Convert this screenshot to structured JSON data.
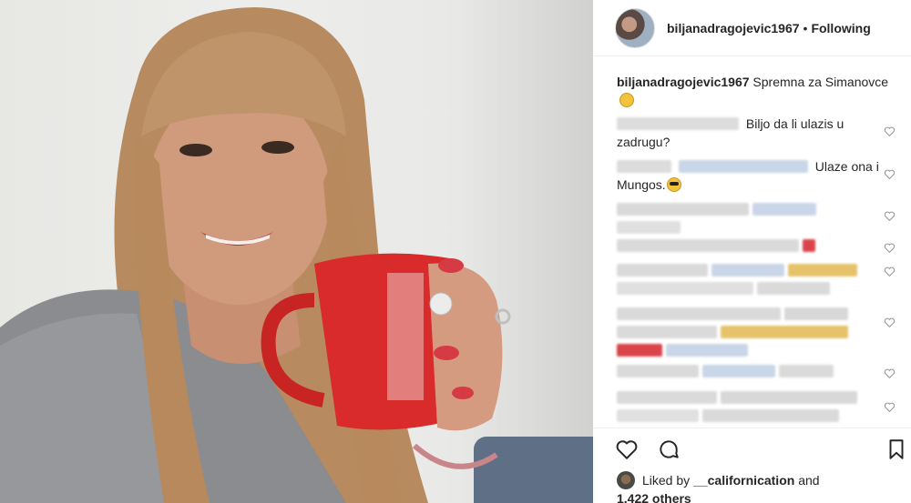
{
  "post": {
    "username": "biljanadragojevic1967",
    "separator": "•",
    "follow_status": "Following",
    "caption_text": "Spremna za Simanovce"
  },
  "comments": [
    {
      "text": "Biljo da li ulazis u zadrugu?"
    },
    {
      "text": "Ulaze ona i Mungos."
    }
  ],
  "likes": {
    "prefix": "Liked by",
    "user": "__californication",
    "suffix": "and",
    "others": "1,422 others"
  },
  "icons": [
    "heart-icon",
    "comment-icon",
    "bookmark-icon",
    "small-heart-icon",
    "smile-emoji",
    "sunglasses-emoji"
  ],
  "colors": {
    "accent": "#262626",
    "divider": "#efefef",
    "mug": "#d92b2b",
    "icon_grey": "#999999"
  }
}
